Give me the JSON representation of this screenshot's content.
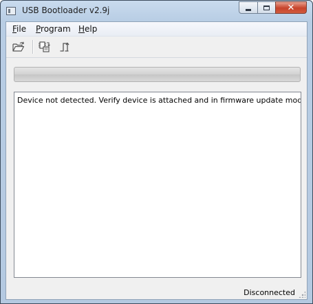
{
  "window": {
    "title": "USB Bootloader v2.9j",
    "controls": {
      "minimize": "minimize-icon",
      "maximize": "maximize-icon",
      "close": "close-icon"
    }
  },
  "menu": [
    {
      "label": "File",
      "underline": "F",
      "rest": "ile"
    },
    {
      "label": "Program",
      "underline": "P",
      "rest": "rogram"
    },
    {
      "label": "Help",
      "underline": "H",
      "rest": "elp"
    }
  ],
  "toolbar": {
    "icons": [
      "open-folder-icon",
      "program-device-icon",
      "reset-device-icon"
    ]
  },
  "progress": {
    "value": 0
  },
  "log": {
    "text": "Device not detected.  Verify device is attached and in firmware update mode."
  },
  "status": {
    "text": "Disconnected"
  }
}
